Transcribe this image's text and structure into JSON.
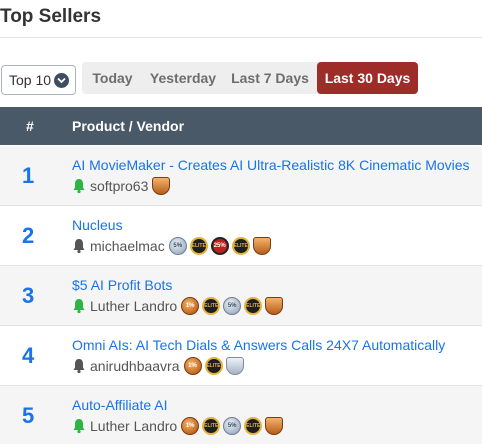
{
  "header": {
    "title": "Top Sellers"
  },
  "controls": {
    "select_value": "Top 10",
    "tabs": [
      {
        "label": "Today",
        "active": false
      },
      {
        "label": "Yesterday",
        "active": false
      },
      {
        "label": "Last 7 Days",
        "active": false
      },
      {
        "label": "Last 30 Days",
        "active": true
      }
    ]
  },
  "table": {
    "columns": [
      "#",
      "Product / Vendor"
    ],
    "rows": [
      {
        "rank": "1",
        "product": "AI MovieMaker - Creates AI Ultra-Realistic 8K Cinematic Movies",
        "vendor": "softpro63",
        "bell": "green-bell-icon",
        "badges": [
          {
            "type": "shield-bronze",
            "icon": "trophy-shield-badge-icon",
            "text": ""
          }
        ]
      },
      {
        "rank": "2",
        "product": "Nucleus",
        "vendor": "michaelmac",
        "bell": "gray-bell-icon",
        "badges": [
          {
            "type": "silver",
            "icon": "silver-badge-icon",
            "text": "5%"
          },
          {
            "type": "elite",
            "icon": "elite-badge-icon",
            "text": "ELITE"
          },
          {
            "type": "red",
            "icon": "percent-badge-icon",
            "text": "25%"
          },
          {
            "type": "elite",
            "icon": "elite-badge-icon",
            "text": "ELITE"
          },
          {
            "type": "shield-bronze",
            "icon": "trophy-shield-badge-icon",
            "text": ""
          }
        ]
      },
      {
        "rank": "3",
        "product": "$5 AI Profit Bots",
        "vendor": "Luther Landro",
        "bell": "green-bell-icon",
        "badges": [
          {
            "type": "bronze",
            "icon": "bronze-badge-icon",
            "text": "1%"
          },
          {
            "type": "elite",
            "icon": "elite-badge-icon",
            "text": "ELITE"
          },
          {
            "type": "silver",
            "icon": "silver-badge-icon",
            "text": "5%"
          },
          {
            "type": "elite",
            "icon": "elite-badge-icon",
            "text": "ELITE"
          },
          {
            "type": "shield-bronze",
            "icon": "trophy-shield-badge-icon",
            "text": ""
          }
        ]
      },
      {
        "rank": "4",
        "product": "Omni AIs: AI Tech Dials & Answers Calls 24X7 Automatically",
        "vendor": "anirudhbaavra",
        "bell": "gray-bell-icon",
        "badges": [
          {
            "type": "bronze",
            "icon": "bronze-badge-icon",
            "text": "1%"
          },
          {
            "type": "elite",
            "icon": "elite-badge-icon",
            "text": "ELITE"
          },
          {
            "type": "shield-silver",
            "icon": "trophy-shield-badge-icon",
            "text": ""
          }
        ]
      },
      {
        "rank": "5",
        "product": "Auto-Affiliate AI",
        "vendor": "Luther Landro",
        "bell": "green-bell-icon",
        "badges": [
          {
            "type": "bronze",
            "icon": "bronze-badge-icon",
            "text": "1%"
          },
          {
            "type": "elite",
            "icon": "elite-badge-icon",
            "text": "ELITE"
          },
          {
            "type": "silver",
            "icon": "silver-badge-icon",
            "text": "5%"
          },
          {
            "type": "elite",
            "icon": "elite-badge-icon",
            "text": "ELITE"
          },
          {
            "type": "shield-bronze",
            "icon": "trophy-shield-badge-icon",
            "text": ""
          }
        ]
      }
    ]
  },
  "colors": {
    "link": "#1a73e8",
    "header_bg": "#4a5968",
    "active_tab": "#9e2d2a",
    "bell_green": "#2fb344",
    "bell_gray": "#555555"
  }
}
